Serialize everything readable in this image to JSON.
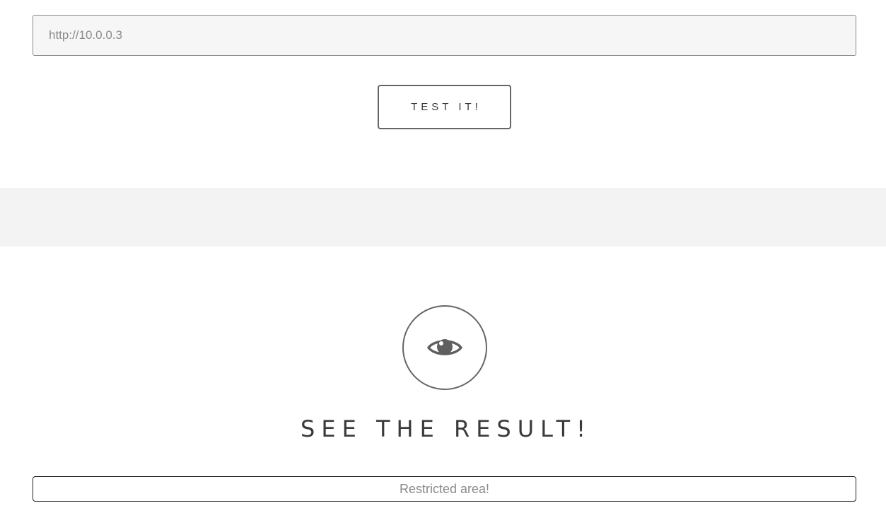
{
  "form": {
    "url_value": "http://10.0.0.3",
    "submit_label": "TEST IT!"
  },
  "result_section": {
    "icon": "eye-icon",
    "title": "SEE THE RESULT!",
    "output_text": "Restricted area!"
  },
  "colors": {
    "input_background": "#f6f6f6",
    "band_background": "#f3f3f3",
    "border": "#666666",
    "text": "#3a3a3a"
  }
}
